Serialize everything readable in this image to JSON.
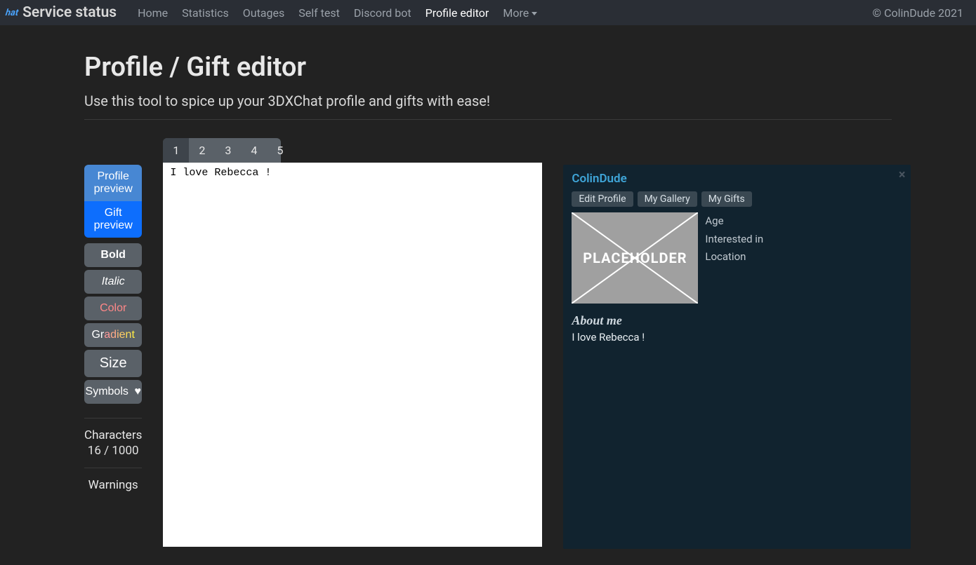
{
  "header": {
    "logo_text": "hat",
    "brand": "Service status",
    "nav": [
      "Home",
      "Statistics",
      "Outages",
      "Self test",
      "Discord bot",
      "Profile editor",
      "More"
    ],
    "active_nav": "Profile editor",
    "copyright": "© ColinDude 2021"
  },
  "page": {
    "title": "Profile / Gift editor",
    "subtitle": "Use this tool to spice up your 3DXChat profile and gifts with ease!"
  },
  "sidebar": {
    "profile_preview": "Profile preview",
    "gift_preview": "Gift preview",
    "bold": "Bold",
    "italic": "Italic",
    "color": "Color",
    "gradient": "Gradient",
    "size": "Size",
    "symbols": "Symbols",
    "heart_glyph": "♥",
    "chars_label": "Characters",
    "chars_value": "16 / 1000",
    "warnings_label": "Warnings"
  },
  "editor": {
    "tabs": [
      "1",
      "2",
      "3",
      "4",
      "5"
    ],
    "active_tab": "1",
    "content": "I love Rebecca !"
  },
  "preview": {
    "username": "ColinDude",
    "tabs": [
      "Edit Profile",
      "My Gallery",
      "My Gifts"
    ],
    "placeholder_label": "PLACEHOLDER",
    "meta": {
      "age": "Age",
      "interested": "Interested in",
      "location": "Location"
    },
    "about_label": "About me",
    "about_text": "I love Rebecca !"
  }
}
